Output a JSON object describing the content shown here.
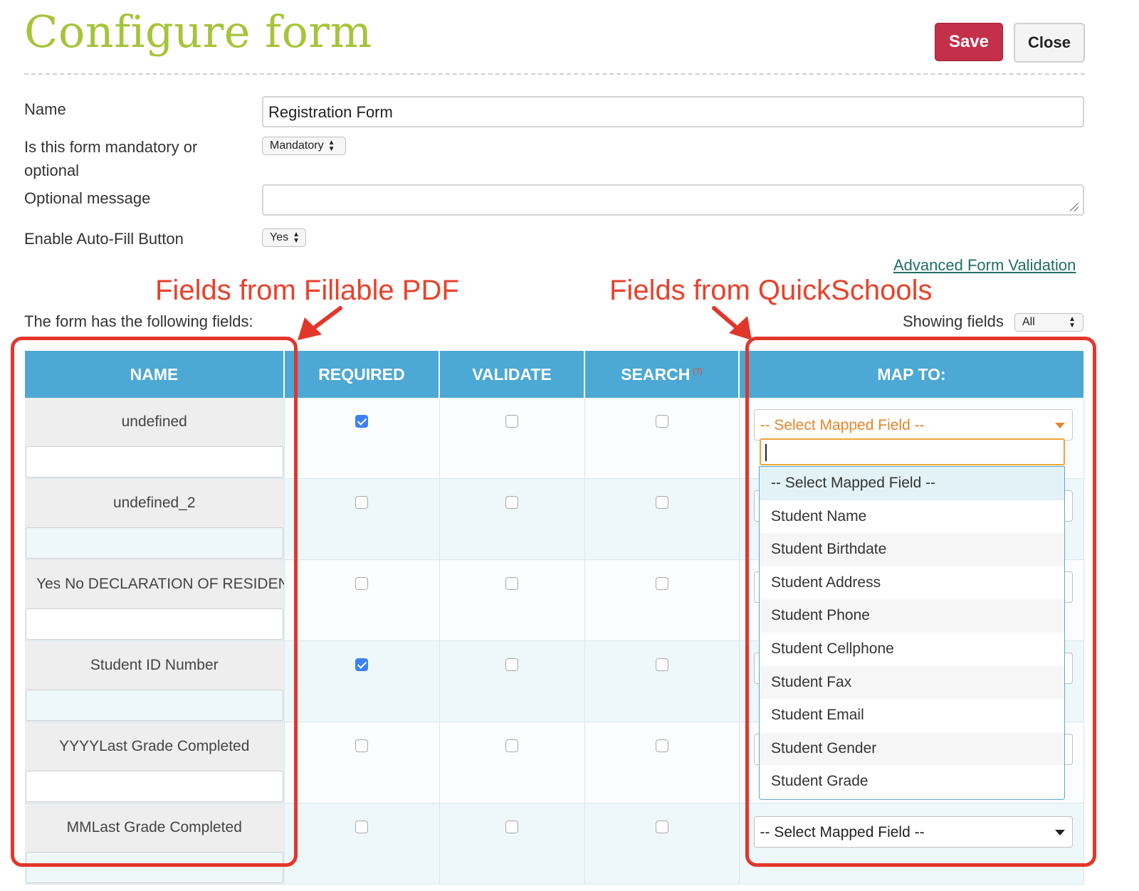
{
  "header": {
    "title": "Configure form",
    "save_label": "Save",
    "close_label": "Close"
  },
  "form": {
    "name_label": "Name",
    "name_value": "Registration Form",
    "mandatory_label_line1": "Is this form mandatory or",
    "mandatory_label_line2": "optional",
    "mandatory_value": "Mandatory",
    "message_label": "Optional message",
    "message_value": "",
    "autofill_label": "Enable Auto-Fill Button",
    "autofill_value": "Yes",
    "advanced_link": "Advanced Form Validation"
  },
  "annotations": {
    "left": "Fields from Fillable PDF",
    "right": "Fields from QuickSchools"
  },
  "fields_section": {
    "intro": "The form has the following fields:",
    "showing_label": "Showing fields",
    "showing_value": "All"
  },
  "table": {
    "headers": {
      "name": "NAME",
      "required": "REQUIRED",
      "validate": "VALIDATE",
      "search": "SEARCH",
      "search_help": "(?)",
      "map_to": "MAP TO:"
    },
    "rows": [
      {
        "name": "undefined",
        "required": true,
        "validate": false,
        "search": false,
        "map": "-- Select Mapped Field --"
      },
      {
        "name": "undefined_2",
        "required": false,
        "validate": false,
        "search": false,
        "map": ""
      },
      {
        "name": "Yes No DECLARATION OF RESIDENCY",
        "required": false,
        "validate": false,
        "search": false,
        "map": ""
      },
      {
        "name": "Student ID Number",
        "required": true,
        "validate": false,
        "search": false,
        "map": ""
      },
      {
        "name": "YYYYLast Grade Completed",
        "required": false,
        "validate": false,
        "search": false,
        "map": ""
      },
      {
        "name": "MMLast Grade Completed",
        "required": false,
        "validate": false,
        "search": false,
        "map": "-- Select Mapped Field --"
      }
    ]
  },
  "dropdown": {
    "search_value": "",
    "options": [
      "-- Select Mapped Field --",
      "Student Name",
      "Student Birthdate",
      "Student Address",
      "Student Phone",
      "Student Cellphone",
      "Student Fax",
      "Student Email",
      "Student Gender",
      "Student Grade"
    ]
  },
  "colors": {
    "accent_green": "#a6c43a",
    "save_red": "#c42f4a",
    "header_blue": "#4ca8d4",
    "annotation_red": "#e3362a",
    "select_orange": "#e6862a"
  }
}
